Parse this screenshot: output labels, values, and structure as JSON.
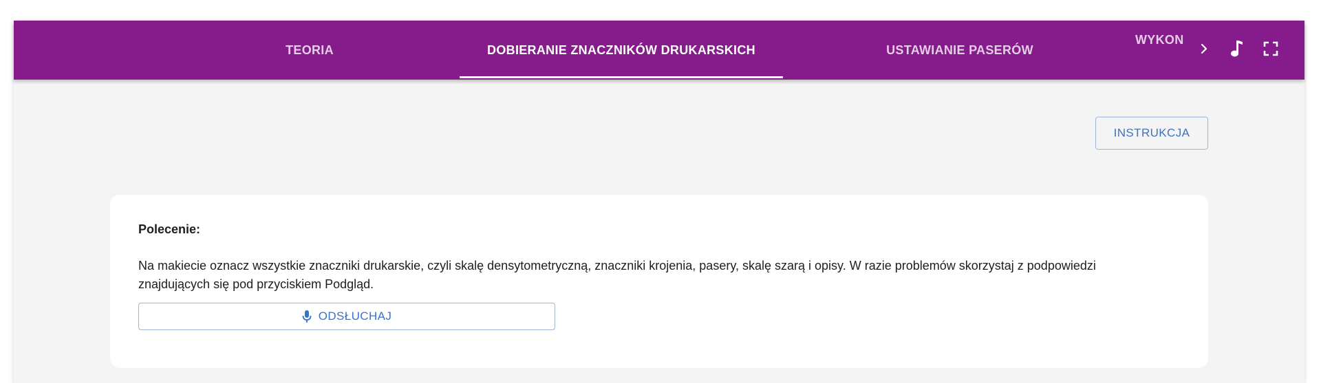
{
  "header": {
    "tabs": [
      {
        "label": "TEORIA",
        "active": false
      },
      {
        "label": "DOBIERANIE ZNACZNIKÓW DRUKARSKICH",
        "active": true
      },
      {
        "label": "USTAWIANIE PASERÓW",
        "active": false
      },
      {
        "label": "WYKONYWANIE",
        "active": false
      }
    ],
    "icons": {
      "scroll_right": "chevron-right-icon",
      "music": "music-note-icon",
      "fullscreen": "fullscreen-icon"
    }
  },
  "toolbar": {
    "instruction_label": "INSTRUKCJA"
  },
  "task": {
    "title": "Polecenie:",
    "text": "Na makiecie oznacz wszystkie znaczniki drukarskie, czyli skalę densytometryczną, znaczniki krojenia, pasery, skalę szarą i opisy. W razie problemów skorzystaj z podpowiedzi znajdujących się pod przyciskiem Podgląd.",
    "listen_label": "ODSŁUCHAJ",
    "listen_icon": "microphone-icon"
  },
  "colors": {
    "header_bg": "#861b8b",
    "accent": "#3b73c4",
    "page_bg": "#f4f4f4"
  }
}
